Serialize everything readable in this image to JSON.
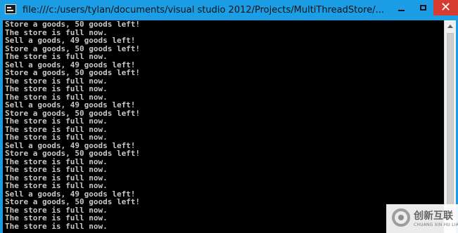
{
  "window": {
    "title": "file:///c:/users/tylan/documents/visual studio 2012/Projects/MultiThreadStore/...",
    "minimize_icon": "minimize-icon",
    "maximize_icon": "restore-icon",
    "close_label": "✕",
    "colors": {
      "titlebar": "#1c9ee6",
      "close": "#d73c31",
      "console": "#000000",
      "text": "#c8c8c8"
    }
  },
  "console": {
    "lines": [
      "Store a goods, 50 goods left!",
      "The store is full now.",
      "Sell a goods, 49 goods left!",
      "Store a goods, 50 goods left!",
      "The store is full now.",
      "Sell a goods, 49 goods left!",
      "Store a goods, 50 goods left!",
      "The store is full now.",
      "The store is full now.",
      "The store is full now.",
      "Sell a goods, 49 goods left!",
      "Store a goods, 50 goods left!",
      "The store is full now.",
      "The store is full now.",
      "The store is full now.",
      "Sell a goods, 49 goods left!",
      "Store a goods, 50 goods left!",
      "The store is full now.",
      "The store is full now.",
      "The store is full now.",
      "The store is full now.",
      "Sell a goods, 49 goods left!",
      "Store a goods, 50 goods left!",
      "The store is full now.",
      "The store is full now.",
      "The store is full now."
    ]
  },
  "watermark": {
    "text_cn": "创新互联",
    "text_en": "CHUANG XIN HU LIAN",
    "logo_icon": "logo-icon"
  }
}
